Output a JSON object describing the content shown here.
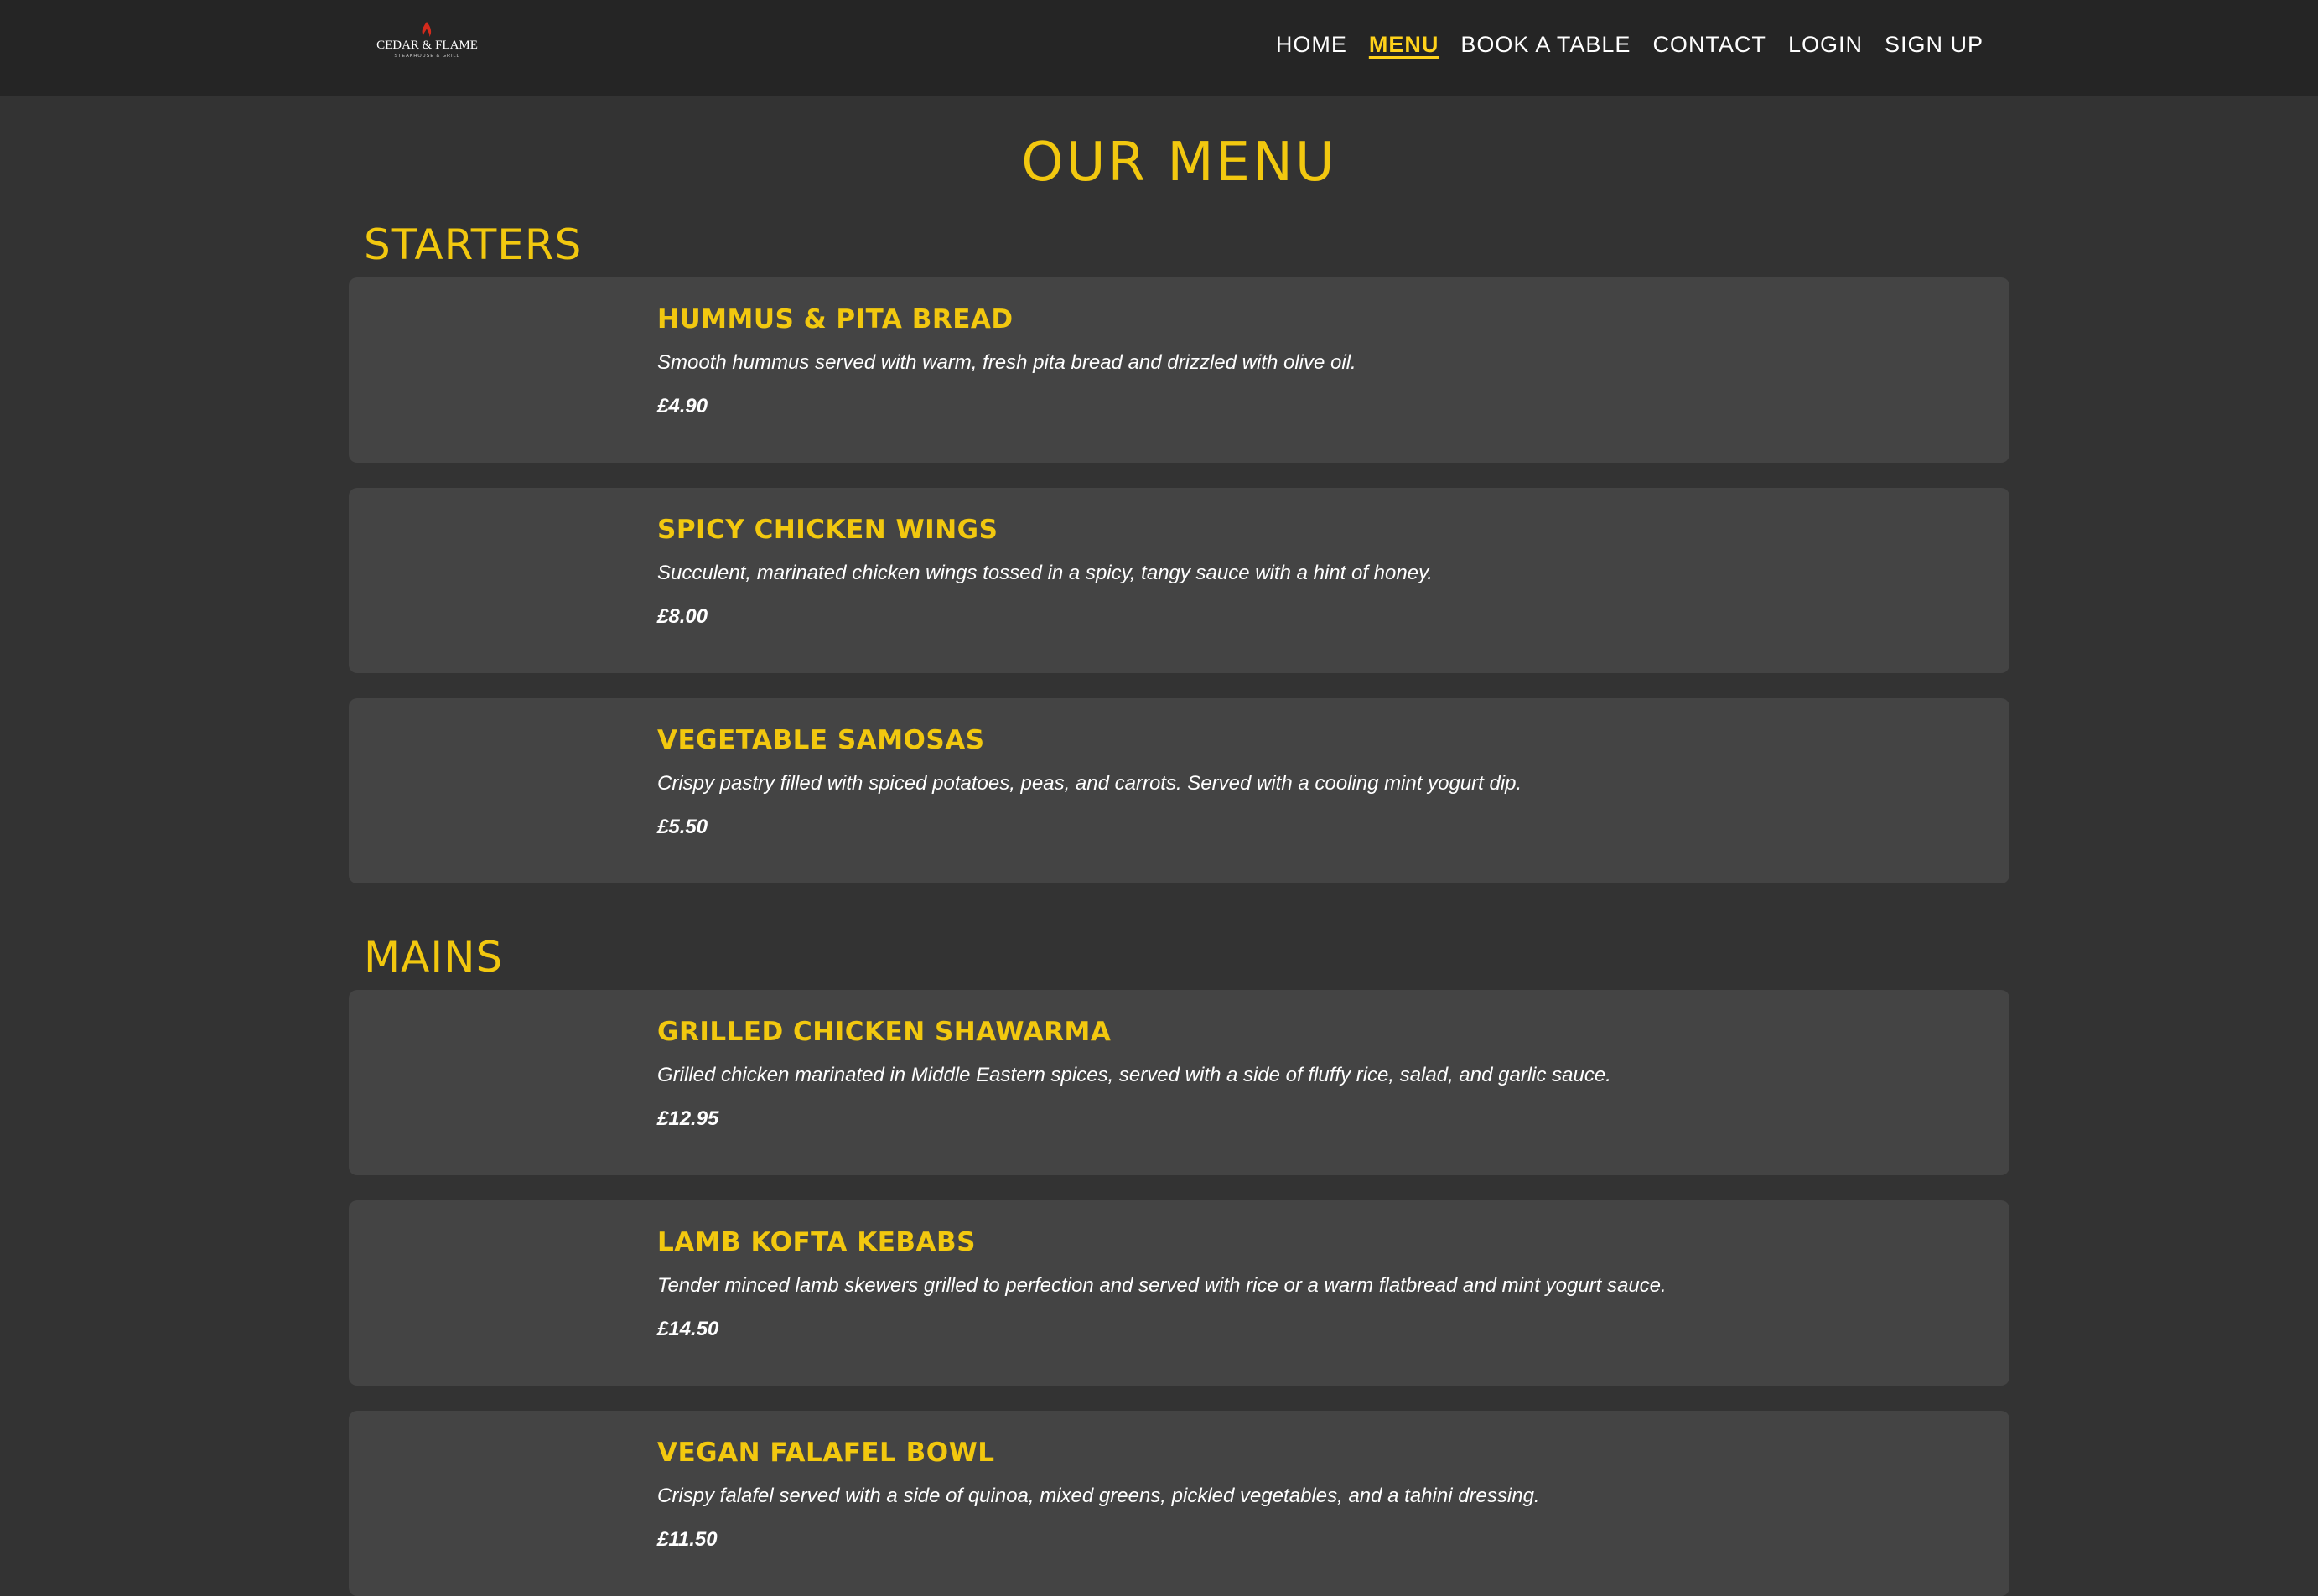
{
  "header": {
    "logo": {
      "name": "CEDAR & FLAME",
      "tagline": "STEAKHOUSE & GRILL",
      "flame_color": "#d42a1c"
    },
    "nav": [
      {
        "label": "HOME",
        "active": false
      },
      {
        "label": "MENU",
        "active": true
      },
      {
        "label": "BOOK A TABLE",
        "active": false
      },
      {
        "label": "CONTACT",
        "active": false
      },
      {
        "label": "LOGIN",
        "active": false
      },
      {
        "label": "SIGN UP",
        "active": false
      }
    ]
  },
  "page": {
    "title": "OUR MENU"
  },
  "sections": [
    {
      "title": "STARTERS",
      "items": [
        {
          "name": "HUMMUS & PITA BREAD",
          "description": "Smooth hummus served with warm, fresh pita bread and drizzled with olive oil.",
          "price": "£4.90"
        },
        {
          "name": "SPICY CHICKEN WINGS",
          "description": "Succulent, marinated chicken wings tossed in a spicy, tangy sauce with a hint of honey.",
          "price": "£8.00"
        },
        {
          "name": "VEGETABLE SAMOSAS",
          "description": "Crispy pastry filled with spiced potatoes, peas, and carrots. Served with a cooling mint yogurt dip.",
          "price": "£5.50"
        }
      ]
    },
    {
      "title": "MAINS",
      "items": [
        {
          "name": "GRILLED CHICKEN SHAWARMA",
          "description": "Grilled chicken marinated in Middle Eastern spices, served with a side of fluffy rice, salad, and garlic sauce.",
          "price": "£12.95"
        },
        {
          "name": "LAMB KOFTA KEBABS",
          "description": "Tender minced lamb skewers grilled to perfection and served with rice or a warm flatbread and mint yogurt sauce.",
          "price": "£14.50"
        },
        {
          "name": "VEGAN FALAFEL BOWL",
          "description": "Crispy falafel served with a side of quinoa, mixed greens, pickled vegetables, and a tahini dressing.",
          "price": "£11.50"
        }
      ]
    }
  ],
  "colors": {
    "accent": "#f2c80f",
    "page_background": "#333333",
    "header_background": "#252525",
    "card_background": "#444444"
  }
}
